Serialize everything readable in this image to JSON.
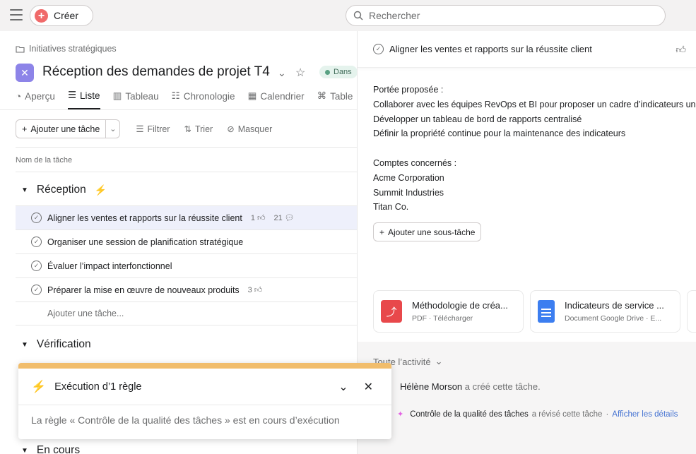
{
  "topbar": {
    "create_label": "Créer",
    "search_placeholder": "Rechercher"
  },
  "project": {
    "breadcrumb": "Initiatives stratégiques",
    "title": "Réception des demandes de projet T4",
    "status": "Dans",
    "tabs": [
      {
        "label": "Aperçu",
        "icon": "overview-icon",
        "active": false
      },
      {
        "label": "Liste",
        "icon": "list-icon",
        "active": true
      },
      {
        "label": "Tableau",
        "icon": "board-icon",
        "active": false
      },
      {
        "label": "Chronologie",
        "icon": "timeline-icon",
        "active": false
      },
      {
        "label": "Calendrier",
        "icon": "calendar-icon",
        "active": false
      },
      {
        "label": "Table",
        "icon": "workflow-icon",
        "active": false
      }
    ]
  },
  "toolbar": {
    "add_task": "Ajouter une tâche",
    "filter": "Filtrer",
    "sort": "Trier",
    "hide": "Masquer"
  },
  "list": {
    "column_header": "Nom de la tâche",
    "sections": [
      {
        "name": "Réception",
        "tasks": [
          {
            "name": "Aligner les ventes et rapports sur la réussite client",
            "likes": "1",
            "comments": "21",
            "selected": true
          },
          {
            "name": "Organiser une session de planification stratégique",
            "likes": "",
            "comments": ""
          },
          {
            "name": "Évaluer l’impact interfonctionnel",
            "likes": "",
            "comments": ""
          },
          {
            "name": "Préparer la mise en œuvre de nouveaux produits",
            "likes": "3",
            "comments": ""
          }
        ],
        "add_task": "Ajouter une tâche..."
      },
      {
        "name": "Vérification"
      },
      {
        "name": "En cours"
      }
    ]
  },
  "toast": {
    "title": "Exécution d’1 règle",
    "body": "La règle « Contrôle de la qualité des tâches » est en cours d’exécution"
  },
  "detail": {
    "title": "Aligner les ventes et rapports sur la réussite client",
    "description": [
      "Portée proposée :",
      "Collaborer avec les équipes RevOps et BI pour proposer un cadre d’indicateurs uni",
      "Développer un tableau de bord de rapports centralisé",
      "Définir la propriété continue pour la maintenance des indicateurs",
      "",
      "Comptes concernés :",
      "Acme Corporation",
      "Summit Industries",
      "Titan Co."
    ],
    "add_subtask": "Ajouter une sous-tâche",
    "attachments": [
      {
        "name": "Méthodologie de créa...",
        "sub": "PDF · Télécharger",
        "icon": "pdf-icon"
      },
      {
        "name": "Indicateurs de service ...",
        "sub": "Document Google Drive · E...",
        "icon": "google-doc-icon"
      }
    ],
    "activity": {
      "filter": "Toute l’activité",
      "entry1_user": "Hélène Morson",
      "entry1_text": "a créé cette tâche.",
      "entry2_rule": "Contrôle de la qualité des tâches",
      "entry2_text": "a révisé cette tâche",
      "entry2_sep": "·",
      "entry2_link": "Afficher les détails"
    }
  }
}
